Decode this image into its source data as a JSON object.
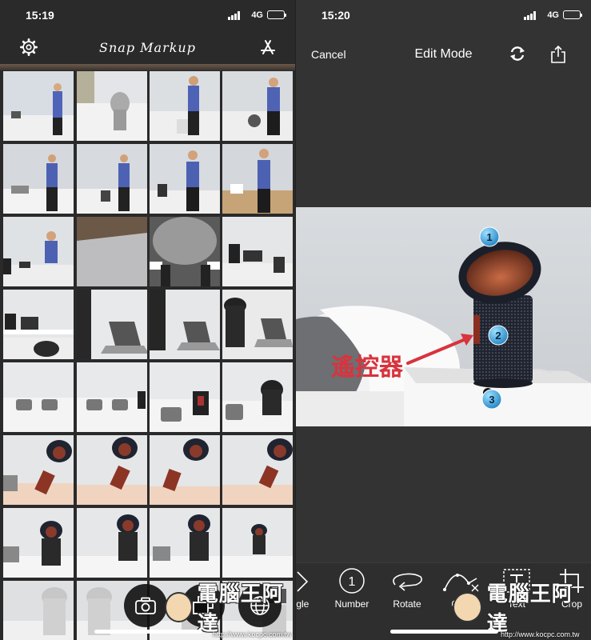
{
  "left_screen": {
    "status": {
      "time": "15:19",
      "network": "4G"
    },
    "header": {
      "logo": "Snap Markup",
      "settings_icon": "gear-icon",
      "store_icon": "app-store-icon"
    },
    "grid": {
      "rows": 8,
      "columns": 4,
      "photos": [
        "bedroom-man",
        "bed-fan",
        "man-standing",
        "man-in-room",
        "man-bed",
        "man-bed",
        "man-presenting",
        "man-presenting",
        "man-laptop",
        "wall-close",
        "fan-corner",
        "laptop-desk",
        "fan-desk",
        "fan-laptop",
        "laptop",
        "laptop-fan",
        "bed-pillows",
        "bed-pillows",
        "bed-pillows",
        "bed-fan",
        "remote-hand",
        "remote-hand",
        "remote-hand",
        "remote-hand",
        "fan-red",
        "fan-red",
        "fan-red",
        "fan-red",
        "fan-white",
        "fan-white",
        "fan-white",
        "fan-white"
      ]
    },
    "bottom_buttons": [
      {
        "name": "camera-button",
        "icon": "camera-icon"
      },
      {
        "name": "layers-button",
        "icon": "layers-icon"
      },
      {
        "name": "web-button",
        "icon": "globe-icon"
      }
    ]
  },
  "right_screen": {
    "status": {
      "time": "15:20",
      "network": "4G"
    },
    "header": {
      "cancel": "Cancel",
      "title": "Edit Mode",
      "refresh_icon": "refresh-icon",
      "share_icon": "share-icon"
    },
    "photo": {
      "markers": [
        "1",
        "2",
        "3"
      ],
      "annotation_text": "遙控器",
      "annotation_color": "#d9333d"
    },
    "toolbar": [
      {
        "label": "ngle",
        "icon": "chevron-icon"
      },
      {
        "label": "Number",
        "icon": "number-circle-icon"
      },
      {
        "label": "Rotate",
        "icon": "rotate-icon"
      },
      {
        "label": "Curv",
        "icon": "curve-icon"
      },
      {
        "label": "Text",
        "icon": "text-box-icon"
      },
      {
        "label": "Crop",
        "icon": "crop-icon"
      }
    ],
    "number_icon_glyph": "1"
  },
  "watermark": {
    "text": "電腦王阿達",
    "url": "http://www.kocpc.com.tw"
  }
}
